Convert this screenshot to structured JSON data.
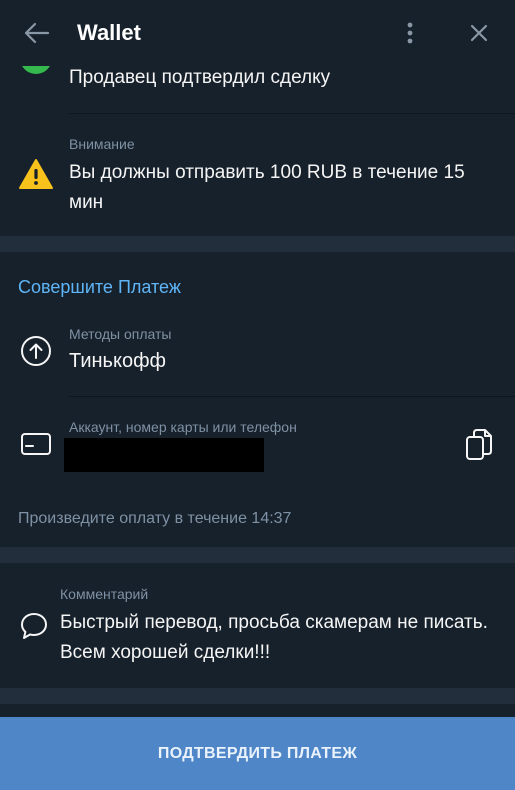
{
  "header": {
    "title": "Wallet",
    "back_icon": "arrow-left-icon",
    "more_icon": "more-vertical-icon",
    "close_icon": "close-icon"
  },
  "status_row": {
    "text": "Продавец подтвердил сделку",
    "icon": "check-circle-icon",
    "color": "#35b94f"
  },
  "warning": {
    "label": "Внимание",
    "text": "Вы должны отправить 100 RUB в течение 15 мин",
    "icon": "warning-triangle-icon",
    "color": "#f7c21b"
  },
  "payment": {
    "section_title": "Совершите Платеж",
    "methods_label": "Методы оплаты",
    "methods_value": "Тинькофф",
    "methods_icon": "arrow-up-circle-icon",
    "account_label": "Аккаунт, номер карты или телефон",
    "account_icon": "card-icon",
    "copy_icon": "copy-icon",
    "timer_text": "Произведите оплату в течение 14:37"
  },
  "comment": {
    "label": "Комментарий",
    "text": "Быстрый перевод, просьба скамерам не писать. Всем хорошей сделки!!!",
    "icon": "chat-bubble-icon"
  },
  "confirm_button": {
    "label": "ПОДТВЕРДИТЬ ПЛАТЕЖ"
  },
  "colors": {
    "background": "#17212b",
    "separator": "#232e3c",
    "accent": "#5eb5f7",
    "button": "#4f86c8",
    "muted": "#7f91a4"
  }
}
